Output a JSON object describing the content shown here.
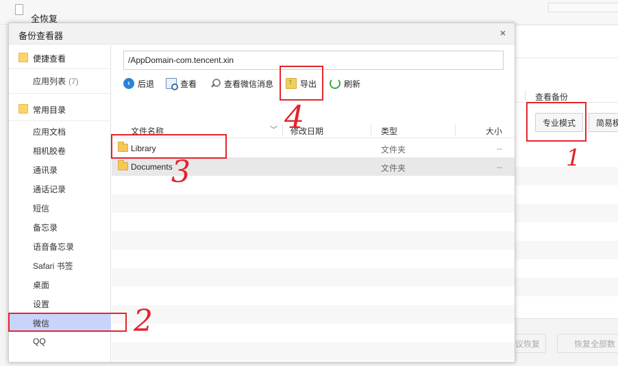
{
  "background": {
    "title": "全恢复",
    "column_header": "查看备份",
    "buttons": {
      "pro_mode": "专业模式",
      "simple_mode": "简易模",
      "restore_partial": "议恢复",
      "restore_all": "恢复全部数"
    }
  },
  "dialog": {
    "title": "备份查看器",
    "close_glyph": "×",
    "sidebar": {
      "sections": [
        {
          "label": "便捷查看",
          "items": [
            {
              "label": "应用列表",
              "count": "(7)"
            }
          ]
        },
        {
          "label": "常用目录",
          "items": [
            {
              "label": "应用文档"
            },
            {
              "label": "相机胶卷"
            },
            {
              "label": "通讯录"
            },
            {
              "label": "通话记录"
            },
            {
              "label": "短信"
            },
            {
              "label": "备忘录"
            },
            {
              "label": "语音备忘录"
            },
            {
              "label": "Safari 书签"
            },
            {
              "label": "桌面"
            },
            {
              "label": "设置"
            },
            {
              "label": "微信"
            },
            {
              "label": "QQ"
            }
          ]
        }
      ],
      "active_item": "微信"
    },
    "path": "/AppDomain-com.tencent.xin",
    "toolbar": {
      "back": "后退",
      "view": "查看",
      "view_wechat": "查看微信消息",
      "export": "导出",
      "refresh": "刷新"
    },
    "columns": {
      "name": "文件名称",
      "modified": "修改日期",
      "type": "类型",
      "size": "大小"
    },
    "rows": [
      {
        "name": "Library",
        "type": "文件夹",
        "size": "--"
      },
      {
        "name": "Documents",
        "type": "文件夹",
        "size": "--",
        "selected": true
      }
    ]
  },
  "annotations": {
    "color": "#e3242b",
    "labels": [
      "1",
      "2",
      "3",
      "4"
    ]
  }
}
